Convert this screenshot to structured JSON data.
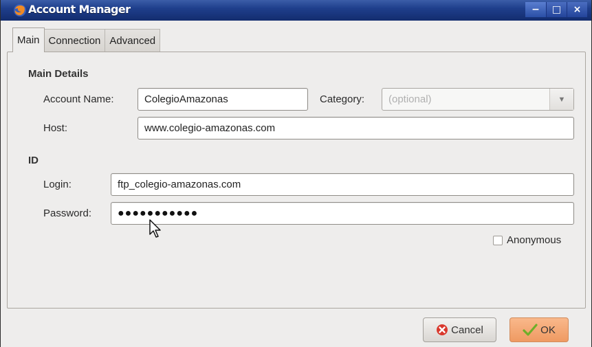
{
  "window": {
    "title": "Account Manager",
    "controls": {
      "minimize": "−",
      "maximize": "□",
      "close": "×"
    }
  },
  "tabs": [
    {
      "label": "Main",
      "active": true
    },
    {
      "label": "Connection",
      "active": false
    },
    {
      "label": "Advanced",
      "active": false
    }
  ],
  "main_details": {
    "section_title": "Main Details",
    "account_name_label": "Account Name:",
    "account_name_value": "ColegioAmazonas",
    "category_label": "Category:",
    "category_placeholder": "(optional)",
    "host_label": "Host:",
    "host_value": "www.colegio-amazonas.com"
  },
  "id_section": {
    "section_title": "ID",
    "login_label": "Login:",
    "login_value": "ftp_colegio-amazonas.com",
    "password_label": "Password:",
    "password_masked": "●●●●●●●●●●●",
    "anonymous_label": "Anonymous",
    "anonymous_checked": false
  },
  "buttons": {
    "cancel_label": "Cancel",
    "ok_label": "OK"
  },
  "icons": {
    "app": "firefox-icon",
    "cancel": "cancel-icon",
    "ok": "checkmark-icon",
    "dropdown": "chevron-down-icon"
  },
  "colors": {
    "titlebar": "#1f3f8c",
    "ok_button": "#ef9a62",
    "cancel_icon": "#d9382c",
    "ok_check": "#6fae2a"
  }
}
